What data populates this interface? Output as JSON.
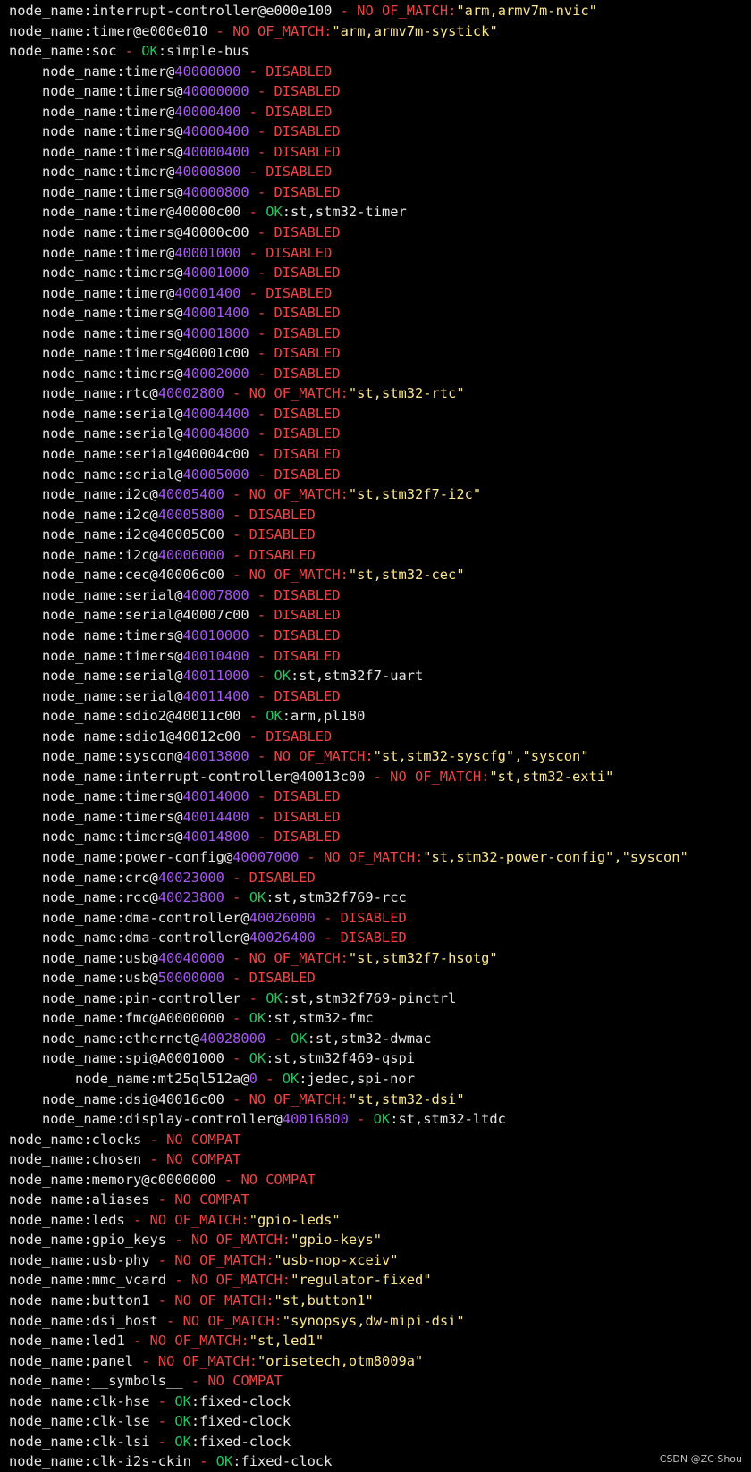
{
  "colors": {
    "background": "#000000",
    "text": "#e6e6e6",
    "red": "#ef4444",
    "green": "#22c55e",
    "yellow": "#fde68a",
    "purple": "#a855f7"
  },
  "watermark": "CSDN @ZC·Shou",
  "lines": [
    {
      "indent": 0,
      "segs": [
        [
          "w",
          "node_name:interrupt-controller@e000e100"
        ],
        [
          "r",
          " - NO OF_MATCH:"
        ],
        [
          "y",
          "\"arm,armv7m-nvic\""
        ]
      ]
    },
    {
      "indent": 0,
      "segs": [
        [
          "w",
          "node_name:timer@e000e010"
        ],
        [
          "r",
          " - NO OF_MATCH:"
        ],
        [
          "y",
          "\"arm,armv7m-systick\""
        ]
      ]
    },
    {
      "indent": 0,
      "segs": [
        [
          "w",
          "node_name:soc"
        ],
        [
          "r",
          " - "
        ],
        [
          "g",
          "OK"
        ],
        [
          "w",
          ":simple-bus"
        ]
      ]
    },
    {
      "indent": 1,
      "segs": [
        [
          "w",
          "node_name:timer@"
        ],
        [
          "p",
          "40000000"
        ],
        [
          "r",
          " - DISABLED"
        ]
      ]
    },
    {
      "indent": 1,
      "segs": [
        [
          "w",
          "node_name:timers@"
        ],
        [
          "p",
          "40000000"
        ],
        [
          "r",
          " - DISABLED"
        ]
      ]
    },
    {
      "indent": 1,
      "segs": [
        [
          "w",
          "node_name:timer@"
        ],
        [
          "p",
          "40000400"
        ],
        [
          "r",
          " - DISABLED"
        ]
      ]
    },
    {
      "indent": 1,
      "segs": [
        [
          "w",
          "node_name:timers@"
        ],
        [
          "p",
          "40000400"
        ],
        [
          "r",
          " - DISABLED"
        ]
      ]
    },
    {
      "indent": 1,
      "segs": [
        [
          "w",
          "node_name:timers@"
        ],
        [
          "p",
          "40000400"
        ],
        [
          "r",
          " - DISABLED"
        ]
      ]
    },
    {
      "indent": 1,
      "segs": [
        [
          "w",
          "node_name:timer@"
        ],
        [
          "p",
          "40000800"
        ],
        [
          "r",
          " - DISABLED"
        ]
      ]
    },
    {
      "indent": 1,
      "segs": [
        [
          "w",
          "node_name:timers@"
        ],
        [
          "p",
          "40000800"
        ],
        [
          "r",
          " - DISABLED"
        ]
      ]
    },
    {
      "indent": 1,
      "segs": [
        [
          "w",
          "node_name:timer@40000c00"
        ],
        [
          "r",
          " - "
        ],
        [
          "g",
          "OK"
        ],
        [
          "w",
          ":st,stm32-timer"
        ]
      ]
    },
    {
      "indent": 1,
      "segs": [
        [
          "w",
          "node_name:timers@40000c00"
        ],
        [
          "r",
          " - DISABLED"
        ]
      ]
    },
    {
      "indent": 1,
      "segs": [
        [
          "w",
          "node_name:timer@"
        ],
        [
          "p",
          "40001000"
        ],
        [
          "r",
          " - DISABLED"
        ]
      ]
    },
    {
      "indent": 1,
      "segs": [
        [
          "w",
          "node_name:timers@"
        ],
        [
          "p",
          "40001000"
        ],
        [
          "r",
          " - DISABLED"
        ]
      ]
    },
    {
      "indent": 1,
      "segs": [
        [
          "w",
          "node_name:timer@"
        ],
        [
          "p",
          "40001400"
        ],
        [
          "r",
          " - DISABLED"
        ]
      ]
    },
    {
      "indent": 1,
      "segs": [
        [
          "w",
          "node_name:timers@"
        ],
        [
          "p",
          "40001400"
        ],
        [
          "r",
          " - DISABLED"
        ]
      ]
    },
    {
      "indent": 1,
      "segs": [
        [
          "w",
          "node_name:timers@"
        ],
        [
          "p",
          "40001800"
        ],
        [
          "r",
          " - DISABLED"
        ]
      ]
    },
    {
      "indent": 1,
      "segs": [
        [
          "w",
          "node_name:timers@40001c00"
        ],
        [
          "r",
          " - DISABLED"
        ]
      ]
    },
    {
      "indent": 1,
      "segs": [
        [
          "w",
          "node_name:timers@"
        ],
        [
          "p",
          "40002000"
        ],
        [
          "r",
          " - DISABLED"
        ]
      ]
    },
    {
      "indent": 1,
      "segs": [
        [
          "w",
          "node_name:rtc@"
        ],
        [
          "p",
          "40002800"
        ],
        [
          "r",
          " - NO OF_MATCH:"
        ],
        [
          "y",
          "\"st,stm32-rtc\""
        ]
      ]
    },
    {
      "indent": 1,
      "segs": [
        [
          "w",
          "node_name:serial@"
        ],
        [
          "p",
          "40004400"
        ],
        [
          "r",
          " - DISABLED"
        ]
      ]
    },
    {
      "indent": 1,
      "segs": [
        [
          "w",
          "node_name:serial@"
        ],
        [
          "p",
          "40004800"
        ],
        [
          "r",
          " - DISABLED"
        ]
      ]
    },
    {
      "indent": 1,
      "segs": [
        [
          "w",
          "node_name:serial@40004c00"
        ],
        [
          "r",
          " - DISABLED"
        ]
      ]
    },
    {
      "indent": 1,
      "segs": [
        [
          "w",
          "node_name:serial@"
        ],
        [
          "p",
          "40005000"
        ],
        [
          "r",
          " - DISABLED"
        ]
      ]
    },
    {
      "indent": 1,
      "segs": [
        [
          "w",
          "node_name:i2c@"
        ],
        [
          "p",
          "40005400"
        ],
        [
          "r",
          " - NO OF_MATCH:"
        ],
        [
          "y",
          "\"st,stm32f7-i2c\""
        ]
      ]
    },
    {
      "indent": 1,
      "segs": [
        [
          "w",
          "node_name:i2c@"
        ],
        [
          "p",
          "40005800"
        ],
        [
          "r",
          " - DISABLED"
        ]
      ]
    },
    {
      "indent": 1,
      "segs": [
        [
          "w",
          "node_name:i2c@40005C00"
        ],
        [
          "r",
          " - DISABLED"
        ]
      ]
    },
    {
      "indent": 1,
      "segs": [
        [
          "w",
          "node_name:i2c@"
        ],
        [
          "p",
          "40006000"
        ],
        [
          "r",
          " - DISABLED"
        ]
      ]
    },
    {
      "indent": 1,
      "segs": [
        [
          "w",
          "node_name:cec@40006c00"
        ],
        [
          "r",
          " - NO OF_MATCH:"
        ],
        [
          "y",
          "\"st,stm32-cec\""
        ]
      ]
    },
    {
      "indent": 1,
      "segs": [
        [
          "w",
          "node_name:serial@"
        ],
        [
          "p",
          "40007800"
        ],
        [
          "r",
          " - DISABLED"
        ]
      ]
    },
    {
      "indent": 1,
      "segs": [
        [
          "w",
          "node_name:serial@40007c00"
        ],
        [
          "r",
          " - DISABLED"
        ]
      ]
    },
    {
      "indent": 1,
      "segs": [
        [
          "w",
          "node_name:timers@"
        ],
        [
          "p",
          "40010000"
        ],
        [
          "r",
          " - DISABLED"
        ]
      ]
    },
    {
      "indent": 1,
      "segs": [
        [
          "w",
          "node_name:timers@"
        ],
        [
          "p",
          "40010400"
        ],
        [
          "r",
          " - DISABLED"
        ]
      ]
    },
    {
      "indent": 1,
      "segs": [
        [
          "w",
          "node_name:serial@"
        ],
        [
          "p",
          "40011000"
        ],
        [
          "r",
          " - "
        ],
        [
          "g",
          "OK"
        ],
        [
          "w",
          ":st,stm32f7-uart"
        ]
      ]
    },
    {
      "indent": 1,
      "segs": [
        [
          "w",
          "node_name:serial@"
        ],
        [
          "p",
          "40011400"
        ],
        [
          "r",
          " - DISABLED"
        ]
      ]
    },
    {
      "indent": 1,
      "segs": [
        [
          "w",
          "node_name:sdio2@40011c00"
        ],
        [
          "r",
          " - "
        ],
        [
          "g",
          "OK"
        ],
        [
          "w",
          ":arm,pl180"
        ]
      ]
    },
    {
      "indent": 1,
      "segs": [
        [
          "w",
          "node_name:sdio1@40012c00"
        ],
        [
          "r",
          " - DISABLED"
        ]
      ]
    },
    {
      "indent": 1,
      "segs": [
        [
          "w",
          "node_name:syscon@"
        ],
        [
          "p",
          "40013800"
        ],
        [
          "r",
          " - NO OF_MATCH:"
        ],
        [
          "y",
          "\"st,stm32-syscfg\",\"syscon\""
        ]
      ]
    },
    {
      "indent": 1,
      "segs": [
        [
          "w",
          "node_name:interrupt-controller@40013c00"
        ],
        [
          "r",
          " - NO OF_MATCH:"
        ],
        [
          "y",
          "\"st,stm32-exti\""
        ]
      ]
    },
    {
      "indent": 1,
      "segs": [
        [
          "w",
          "node_name:timers@"
        ],
        [
          "p",
          "40014000"
        ],
        [
          "r",
          " - DISABLED"
        ]
      ]
    },
    {
      "indent": 1,
      "segs": [
        [
          "w",
          "node_name:timers@"
        ],
        [
          "p",
          "40014400"
        ],
        [
          "r",
          " - DISABLED"
        ]
      ]
    },
    {
      "indent": 1,
      "segs": [
        [
          "w",
          "node_name:timers@"
        ],
        [
          "p",
          "40014800"
        ],
        [
          "r",
          " - DISABLED"
        ]
      ]
    },
    {
      "indent": 1,
      "segs": [
        [
          "w",
          "node_name:power-config@"
        ],
        [
          "p",
          "40007000"
        ],
        [
          "r",
          " - NO OF_MATCH:"
        ],
        [
          "y",
          "\"st,stm32-power-config\",\"syscon\""
        ]
      ]
    },
    {
      "indent": 1,
      "segs": [
        [
          "w",
          "node_name:crc@"
        ],
        [
          "p",
          "40023000"
        ],
        [
          "r",
          " - DISABLED"
        ]
      ]
    },
    {
      "indent": 1,
      "segs": [
        [
          "w",
          "node_name:rcc@"
        ],
        [
          "p",
          "40023800"
        ],
        [
          "r",
          " - "
        ],
        [
          "g",
          "OK"
        ],
        [
          "w",
          ":st,stm32f769-rcc"
        ]
      ]
    },
    {
      "indent": 1,
      "segs": [
        [
          "w",
          "node_name:dma-controller@"
        ],
        [
          "p",
          "40026000"
        ],
        [
          "r",
          " - DISABLED"
        ]
      ]
    },
    {
      "indent": 1,
      "segs": [
        [
          "w",
          "node_name:dma-controller@"
        ],
        [
          "p",
          "40026400"
        ],
        [
          "r",
          " - DISABLED"
        ]
      ]
    },
    {
      "indent": 1,
      "segs": [
        [
          "w",
          "node_name:usb@"
        ],
        [
          "p",
          "40040000"
        ],
        [
          "r",
          " - NO OF_MATCH:"
        ],
        [
          "y",
          "\"st,stm32f7-hsotg\""
        ]
      ]
    },
    {
      "indent": 1,
      "segs": [
        [
          "w",
          "node_name:usb@"
        ],
        [
          "p",
          "50000000"
        ],
        [
          "r",
          " - DISABLED"
        ]
      ]
    },
    {
      "indent": 1,
      "segs": [
        [
          "w",
          "node_name:pin-controller"
        ],
        [
          "r",
          " - "
        ],
        [
          "g",
          "OK"
        ],
        [
          "w",
          ":st,stm32f769-pinctrl"
        ]
      ]
    },
    {
      "indent": 1,
      "segs": [
        [
          "w",
          "node_name:fmc@A0000000"
        ],
        [
          "r",
          " - "
        ],
        [
          "g",
          "OK"
        ],
        [
          "w",
          ":st,stm32-fmc"
        ]
      ]
    },
    {
      "indent": 1,
      "segs": [
        [
          "w",
          "node_name:ethernet@"
        ],
        [
          "p",
          "40028000"
        ],
        [
          "r",
          " - "
        ],
        [
          "g",
          "OK"
        ],
        [
          "w",
          ":st,stm32-dwmac"
        ]
      ]
    },
    {
      "indent": 1,
      "segs": [
        [
          "w",
          "node_name:spi@A0001000"
        ],
        [
          "r",
          " - "
        ],
        [
          "g",
          "OK"
        ],
        [
          "w",
          ":st,stm32f469-qspi"
        ]
      ]
    },
    {
      "indent": 2,
      "segs": [
        [
          "w",
          "node_name:mt25ql512a@"
        ],
        [
          "p",
          "0"
        ],
        [
          "r",
          " - "
        ],
        [
          "g",
          "OK"
        ],
        [
          "w",
          ":jedec,spi-nor"
        ]
      ]
    },
    {
      "indent": 1,
      "segs": [
        [
          "w",
          "node_name:dsi@40016c00"
        ],
        [
          "r",
          " - NO OF_MATCH:"
        ],
        [
          "y",
          "\"st,stm32-dsi\""
        ]
      ]
    },
    {
      "indent": 1,
      "segs": [
        [
          "w",
          "node_name:display-controller@"
        ],
        [
          "p",
          "40016800"
        ],
        [
          "r",
          " - "
        ],
        [
          "g",
          "OK"
        ],
        [
          "w",
          ":st,stm32-ltdc"
        ]
      ]
    },
    {
      "indent": 0,
      "segs": [
        [
          "w",
          "node_name:clocks"
        ],
        [
          "r",
          " - NO COMPAT"
        ]
      ]
    },
    {
      "indent": 0,
      "segs": [
        [
          "w",
          "node_name:chosen"
        ],
        [
          "r",
          " - NO COMPAT"
        ]
      ]
    },
    {
      "indent": 0,
      "segs": [
        [
          "w",
          "node_name:memory@c0000000"
        ],
        [
          "r",
          " - NO COMPAT"
        ]
      ]
    },
    {
      "indent": 0,
      "segs": [
        [
          "w",
          "node_name:aliases"
        ],
        [
          "r",
          " - NO COMPAT"
        ]
      ]
    },
    {
      "indent": 0,
      "segs": [
        [
          "w",
          "node_name:leds"
        ],
        [
          "r",
          " - NO OF_MATCH:"
        ],
        [
          "y",
          "\"gpio-leds\""
        ]
      ]
    },
    {
      "indent": 0,
      "segs": [
        [
          "w",
          "node_name:gpio_keys"
        ],
        [
          "r",
          " - NO OF_MATCH:"
        ],
        [
          "y",
          "\"gpio-keys\""
        ]
      ]
    },
    {
      "indent": 0,
      "segs": [
        [
          "w",
          "node_name:usb-phy"
        ],
        [
          "r",
          " - NO OF_MATCH:"
        ],
        [
          "y",
          "\"usb-nop-xceiv\""
        ]
      ]
    },
    {
      "indent": 0,
      "segs": [
        [
          "w",
          "node_name:mmc_vcard"
        ],
        [
          "r",
          " - NO OF_MATCH:"
        ],
        [
          "y",
          "\"regulator-fixed\""
        ]
      ]
    },
    {
      "indent": 0,
      "segs": [
        [
          "w",
          "node_name:button1"
        ],
        [
          "r",
          " - NO OF_MATCH:"
        ],
        [
          "y",
          "\"st,button1\""
        ]
      ]
    },
    {
      "indent": 0,
      "segs": [
        [
          "w",
          "node_name:dsi_host"
        ],
        [
          "r",
          " - NO OF_MATCH:"
        ],
        [
          "y",
          "\"synopsys,dw-mipi-dsi\""
        ]
      ]
    },
    {
      "indent": 0,
      "segs": [
        [
          "w",
          "node_name:led1"
        ],
        [
          "r",
          " - NO OF_MATCH:"
        ],
        [
          "y",
          "\"st,led1\""
        ]
      ]
    },
    {
      "indent": 0,
      "segs": [
        [
          "w",
          "node_name:panel"
        ],
        [
          "r",
          " - NO OF_MATCH:"
        ],
        [
          "y",
          "\"orisetech,otm8009a\""
        ]
      ]
    },
    {
      "indent": 0,
      "segs": [
        [
          "w",
          "node_name:__symbols__"
        ],
        [
          "r",
          " - NO COMPAT"
        ]
      ]
    },
    {
      "indent": 0,
      "segs": [
        [
          "w",
          "node_name:clk-hse"
        ],
        [
          "r",
          " - "
        ],
        [
          "g",
          "OK"
        ],
        [
          "w",
          ":fixed-clock"
        ]
      ]
    },
    {
      "indent": 0,
      "segs": [
        [
          "w",
          "node_name:clk-lse"
        ],
        [
          "r",
          " - "
        ],
        [
          "g",
          "OK"
        ],
        [
          "w",
          ":fixed-clock"
        ]
      ]
    },
    {
      "indent": 0,
      "segs": [
        [
          "w",
          "node_name:clk-lsi"
        ],
        [
          "r",
          " - "
        ],
        [
          "g",
          "OK"
        ],
        [
          "w",
          ":fixed-clock"
        ]
      ]
    },
    {
      "indent": 0,
      "segs": [
        [
          "w",
          "node_name:clk-i2s-ckin"
        ],
        [
          "r",
          " - "
        ],
        [
          "g",
          "OK"
        ],
        [
          "w",
          ":fixed-clock"
        ]
      ]
    }
  ]
}
